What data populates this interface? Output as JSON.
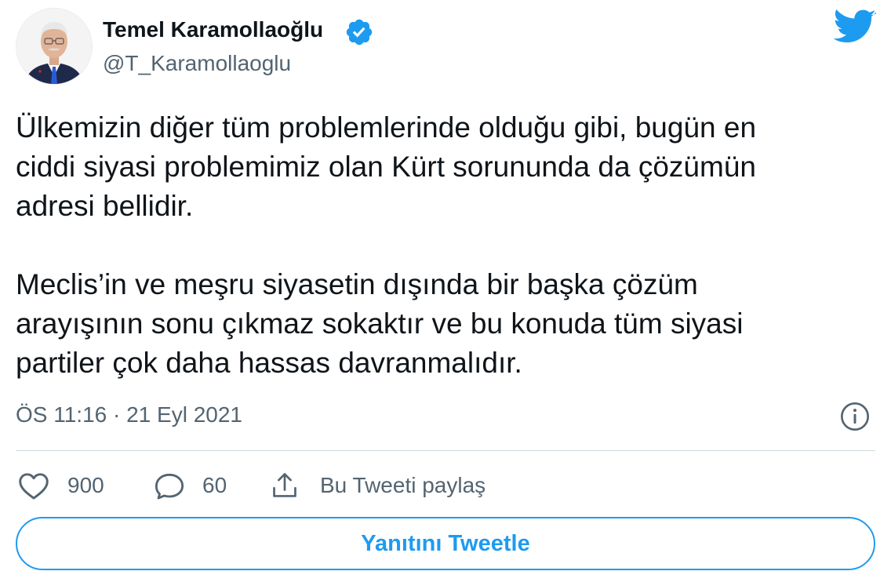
{
  "user": {
    "display_name": "Temel Karamollaoğlu",
    "handle": "@T_Karamollaoglu",
    "verified": true,
    "avatar_icon": "profile-photo"
  },
  "brand": {
    "logo_icon": "twitter-bird-icon",
    "accent_color": "#1d9bf0"
  },
  "tweet": {
    "paragraphs": [
      "Ülkemizin diğer tüm problemlerinde olduğu gibi, bugün en\nciddi siyasi problemimiz olan Kürt sorununda da çözümün\nadresi bellidir.",
      "Meclis’in ve meşru siyasetin dışında bir başka çözüm\narayışının sonu çıkmaz sokaktır ve bu konuda tüm siyasi\npartiler çok daha hassas davranmalıdır."
    ],
    "timestamp": "ÖS 11:16 · 21 Eyl 2021"
  },
  "actions": {
    "likes": "900",
    "replies": "60",
    "share_label": "Bu Tweeti paylaş"
  },
  "reply_button_label": "Yanıtını Tweetle"
}
